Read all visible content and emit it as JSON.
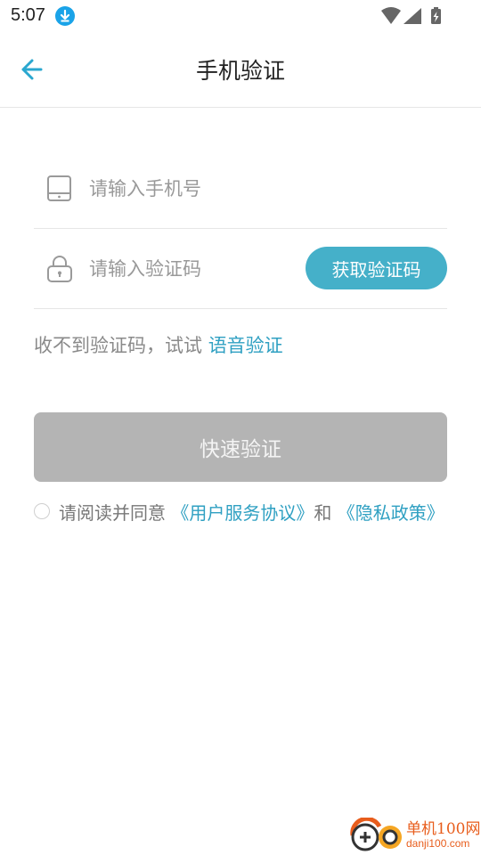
{
  "status_bar": {
    "time": "5:07",
    "icons": [
      "download-icon",
      "wifi-icon",
      "signal-icon",
      "battery-charging-icon"
    ]
  },
  "header": {
    "title": "手机验证",
    "back_icon": "arrow-left-icon"
  },
  "form": {
    "phone_placeholder": "请输入手机号",
    "phone_icon": "phone-icon",
    "code_placeholder": "请输入验证码",
    "code_icon": "lock-icon",
    "get_code_label": "获取验证码"
  },
  "hint": {
    "prefix": "收不到验证码，试试 ",
    "link": "语音验证"
  },
  "submit_label": "快速验证",
  "agreement": {
    "prefix": "请阅读并同意 ",
    "terms": "《用户服务协议》",
    "conjunction": "和 ",
    "privacy": "《隐私政策》"
  },
  "watermark": {
    "name": "单机100网",
    "url": "danji100.com"
  },
  "colors": {
    "accent": "#45b0c9",
    "link": "#2fa0c2",
    "disabled_button": "#b4b4b4",
    "back_arrow": "#2aa7cf"
  }
}
